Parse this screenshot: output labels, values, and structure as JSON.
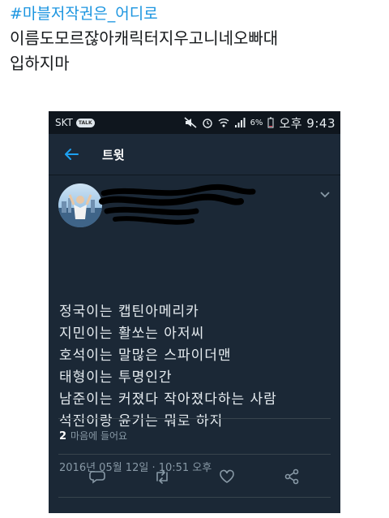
{
  "outer": {
    "hashtag": "#마블저작권은_어디로",
    "caption_line1": "이름도모르잖아캐릭터지우고니네오빠대",
    "caption_line2": "입하지마"
  },
  "statusbar": {
    "carrier": "SKT",
    "talk_badge": "TALK",
    "battery": "6%",
    "time": "오후 9:43"
  },
  "appbar": {
    "title": "트윗"
  },
  "tweet": {
    "lines": [
      "정국이는 캡틴아메리카",
      "지민이는 활쏘는 아저씨",
      "호석이는 말많은 스파이더맨",
      "태형이는 투명인간",
      "남준이는 커졌다 작아졌다하는 사람",
      "석진이랑 윤기는 뭐로 하지"
    ],
    "timestamp": "2016년 05월 12일 · 10:51 오후",
    "likes_count": "2",
    "likes_label": "마음에 들어요"
  },
  "icons": {
    "back": "back-arrow-icon",
    "caret": "chevron-down-icon",
    "reply": "reply-icon",
    "retweet": "retweet-icon",
    "like": "heart-icon",
    "share": "share-icon"
  },
  "colors": {
    "link": "#1b95e0",
    "accent": "#1da1f2",
    "background": "#1b2836",
    "statusbar": "#0f161e"
  }
}
